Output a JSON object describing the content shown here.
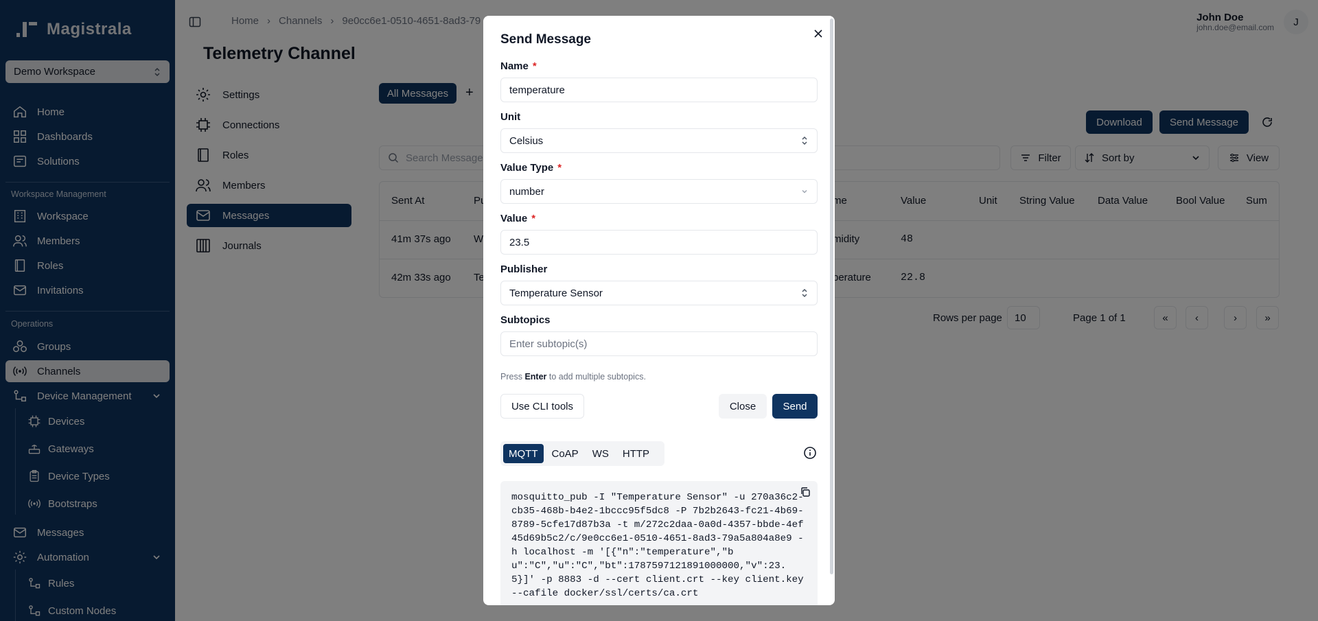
{
  "app": {
    "logo_text": "Magistrala"
  },
  "sidebar": {
    "workspace_select": "Demo Workspace",
    "items": [
      {
        "label": "Home",
        "icon": "home-icon"
      },
      {
        "label": "Dashboards",
        "icon": "dashboard-icon"
      },
      {
        "label": "Solutions",
        "icon": "solutions-icon"
      }
    ],
    "section_workspace": "Workspace Management",
    "workspace_items": [
      {
        "label": "Workspace",
        "icon": "building-icon"
      },
      {
        "label": "Members",
        "icon": "users-icon"
      },
      {
        "label": "Roles",
        "icon": "book-icon"
      },
      {
        "label": "Invitations",
        "icon": "mail-icon"
      }
    ],
    "section_operations": "Operations",
    "operation_items": [
      {
        "label": "Groups",
        "icon": "groups-icon"
      },
      {
        "label": "Channels",
        "icon": "radio-icon"
      },
      {
        "label": "Device Management",
        "icon": "device-management-icon"
      }
    ],
    "device_items": [
      {
        "label": "Devices",
        "icon": "cpu-icon"
      },
      {
        "label": "Gateways",
        "icon": "gateway-icon"
      },
      {
        "label": "Device Types",
        "icon": "clipboard-icon"
      },
      {
        "label": "Bootstraps",
        "icon": "signal-icon"
      }
    ],
    "more_items": [
      {
        "label": "Messages",
        "icon": "mail-icon"
      },
      {
        "label": "Automation",
        "icon": "gear-icon"
      }
    ],
    "automation_items": [
      {
        "label": "Rules",
        "icon": "rules-icon"
      },
      {
        "label": "Custom Nodes",
        "icon": "nodes-icon"
      }
    ]
  },
  "header": {
    "breadcrumbs": [
      "Home",
      "Channels",
      "9e0cc6e1-0510-4651-8ad3-79"
    ],
    "user_name": "John Doe",
    "user_email": "john.doe@email.com",
    "avatar_initial": "J"
  },
  "page": {
    "title": "Telemetry Channel"
  },
  "channel_nav": [
    {
      "label": "Settings",
      "icon": "gear-icon"
    },
    {
      "label": "Connections",
      "icon": "cpu-icon"
    },
    {
      "label": "Roles",
      "icon": "book-icon"
    },
    {
      "label": "Members",
      "icon": "users-icon"
    },
    {
      "label": "Messages",
      "icon": "mail-icon"
    },
    {
      "label": "Journals",
      "icon": "journal-icon"
    }
  ],
  "messages": {
    "tab_all": "All Messages",
    "add_tab": "+",
    "download": "Download",
    "send_message": "Send Message",
    "search_placeholder": "Search Message",
    "filter": "Filter",
    "sort_by": "Sort by",
    "view": "View",
    "columns": [
      "Sent At",
      "Pu",
      "me",
      "Value",
      "Unit",
      "String Value",
      "Data Value",
      "Bool Value",
      "Sum"
    ],
    "rows": [
      {
        "sent_at": "41m 37s ago",
        "publisher": "W",
        "name": "midity",
        "value": "48"
      },
      {
        "sent_at": "42m 33s ago",
        "publisher": "Te",
        "name": "perature",
        "value": "22.8"
      }
    ],
    "rows_per_page_label": "Rows per page",
    "rows_per_page": "10",
    "page_label": "Page 1 of 1"
  },
  "modal": {
    "title": "Send Message",
    "name_label": "Name",
    "name_value": "temperature",
    "unit_label": "Unit",
    "unit_value": "Celsius",
    "value_type_label": "Value Type",
    "value_type_value": "number",
    "value_label": "Value",
    "value_value": "23.5",
    "publisher_label": "Publisher",
    "publisher_value": "Temperature Sensor",
    "subtopics_label": "Subtopics",
    "subtopics_placeholder": "Enter subtopic(s)",
    "hint_pre": "Press",
    "hint_key": "Enter",
    "hint_post": "to add multiple subtopics.",
    "required_mark": "*",
    "cli_button": "Use CLI tools",
    "close_button": "Close",
    "send_button": "Send",
    "protocol_tabs": [
      "MQTT",
      "CoAP",
      "WS",
      "HTTP"
    ],
    "active_protocol": "MQTT",
    "command": "mosquitto_pub -I \"Temperature Sensor\" -u 270a36c2-cb35-468b-b4e2-1bccc95f5dc8 -P 7b2b2643-fc21-4b69-8789-5cfe17d87b3a -t m/272c2daa-0a0d-4357-bbde-4ef45d69b5c2/c/9e0cc6e1-0510-4651-8ad3-79a5a804a8e9 -h localhost -m '[{\"n\":\"temperature\",\"bu\":\"C\",\"u\":\"C\",\"bt\":1787597121891000000,\"v\":23.5}]' -p 8883 -d --cert client.crt --key client.key --cafile docker/ssl/certs/ca.crt"
  },
  "colors": {
    "brand": "#0f3460",
    "required": "#dc2626",
    "overlay": "rgba(0,0,0,0.5)"
  }
}
